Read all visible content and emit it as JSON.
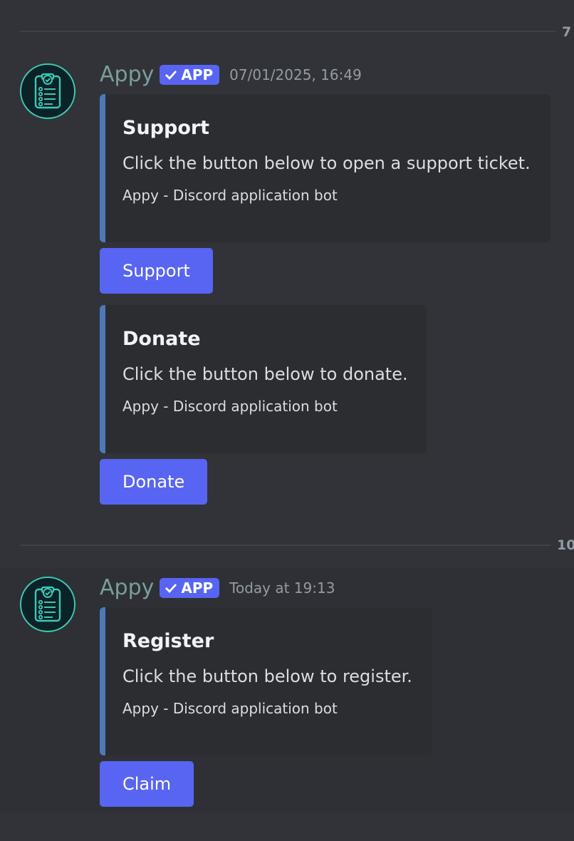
{
  "dividers": [
    {
      "label": "7"
    },
    {
      "label": "10"
    }
  ],
  "messages": [
    {
      "username": "Appy",
      "badge": "APP",
      "timestamp": "07/01/2025, 16:49",
      "avatar_icon": "clipboard-checklist-icon",
      "embeds": [
        {
          "title": "Support",
          "description": "Click the button below to open a support ticket.",
          "footer": "Appy - Discord application bot",
          "button_label": "Support"
        },
        {
          "title": "Donate",
          "description": "Click the button below to donate.",
          "footer": "Appy - Discord application bot",
          "button_label": "Donate"
        }
      ]
    },
    {
      "username": "Appy",
      "badge": "APP",
      "timestamp": "Today at 19:13",
      "avatar_icon": "clipboard-checklist-icon",
      "embeds": [
        {
          "title": "Register",
          "description": "Click the button below to register.",
          "footer": "Appy - Discord application bot",
          "button_label": "Claim"
        }
      ]
    }
  ],
  "colors": {
    "background": "#313338",
    "embed_background": "#2b2d31",
    "embed_accent": "#4e78b8",
    "button": "#5865f2",
    "username": "#7b9e9a",
    "avatar_ring": "#3ec7b6"
  }
}
